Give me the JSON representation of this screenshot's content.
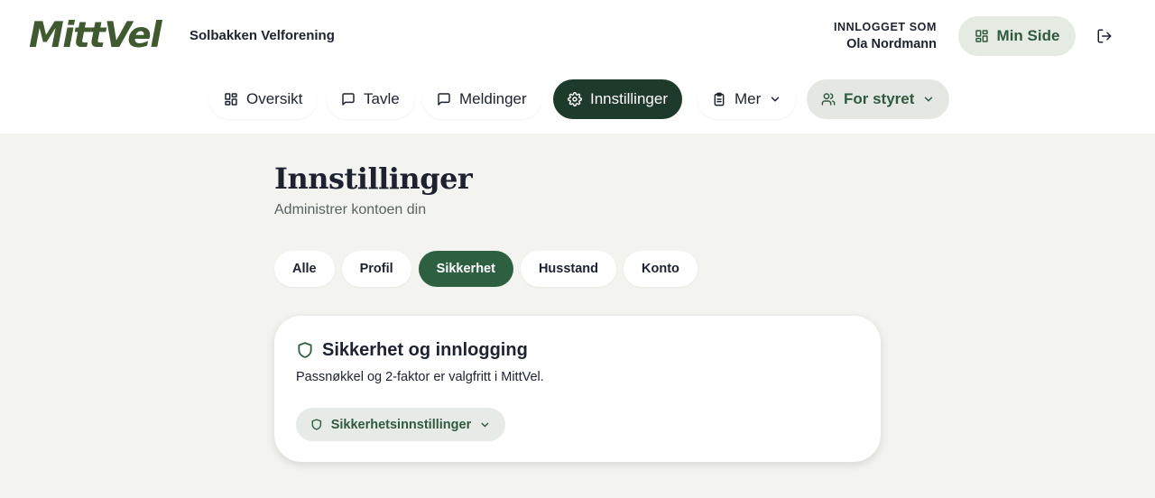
{
  "header": {
    "logo_text": "MittVel",
    "org_name": "Solbakken Velforening",
    "logged_in_caption": "INNLOGGET SOM",
    "user_name": "Ola Nordmann",
    "my_page_label": "Min Side"
  },
  "nav": {
    "items": [
      {
        "label": "Oversikt",
        "icon": "grid-icon"
      },
      {
        "label": "Tavle",
        "icon": "message-square-icon"
      },
      {
        "label": "Meldinger",
        "icon": "message-square-icon"
      },
      {
        "label": "Innstillinger",
        "icon": "gear-icon",
        "active": true
      },
      {
        "label": "Mer",
        "icon": "clipboard-icon",
        "dropdown": true
      },
      {
        "label": "For styret",
        "icon": "users-icon",
        "dropdown": true
      }
    ]
  },
  "page": {
    "title": "Innstillinger",
    "subtitle": "Administrer kontoen din"
  },
  "tabs": [
    {
      "label": "Alle"
    },
    {
      "label": "Profil"
    },
    {
      "label": "Sikkerhet",
      "active": true
    },
    {
      "label": "Husstand"
    },
    {
      "label": "Konto"
    }
  ],
  "security_card": {
    "title": "Sikkerhet og innlogging",
    "description": "Passnøkkel og 2-faktor er valgfritt i MittVel.",
    "button_label": "Sikkerhetsinnstillinger",
    "icon": "shield-icon"
  },
  "colors": {
    "brand_green": "#3f5a2f",
    "active_nav": "#1d3a2b",
    "active_tab": "#2d6040",
    "page_bg": "#f3f4ef"
  }
}
